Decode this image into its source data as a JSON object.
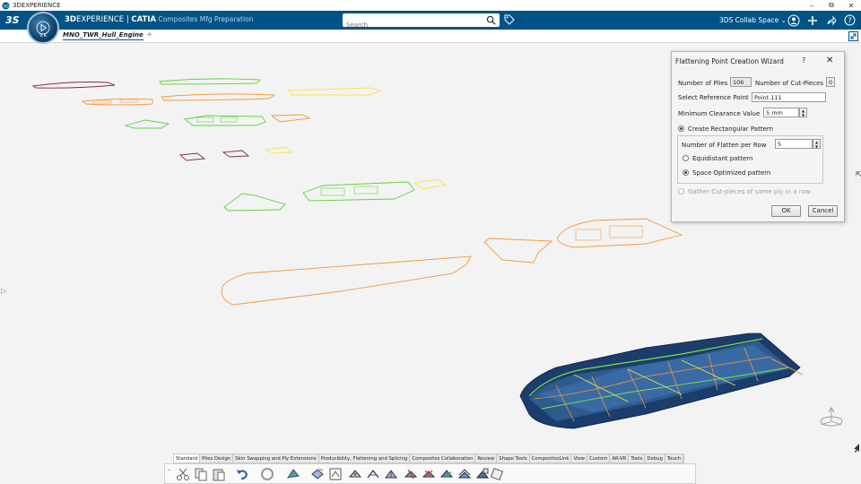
{
  "os": {
    "title": "3DEXPERIENCE",
    "minimize": "–",
    "restore": "⧉",
    "close": "✕"
  },
  "header": {
    "brand_bold": "3D",
    "brand_regular": "EXPERIENCE | ",
    "brand_app_bold": "CATIA",
    "brand_app": " Composites Mfg Preparation",
    "compass_version": "V.R",
    "search_placeholder": "Search",
    "collab_space": "3DS Collab Space ⌄"
  },
  "tabs": {
    "document": "MNO_TWR_Hull_Engineeri",
    "add": "+"
  },
  "dialog": {
    "title": "Flattening Point Creation Wizard",
    "help": "?",
    "close": "✕",
    "plies_label": "Number of Plies",
    "plies_value": "106",
    "cutpieces_label": "Number of Cut-Pieces",
    "cutpieces_value": "0",
    "ref_point_label": "Select Reference Point",
    "ref_point_value": "Point.111",
    "clearance_label": "Minimum Clearance Value",
    "clearance_value": "5 mm",
    "rect_pattern_label": "Create Rectangular Pattern",
    "flatten_per_row_label": "Number of Flatten per Row",
    "flatten_per_row_value": "5",
    "equidistant_label": "Equidistant pattern",
    "space_optimized_label": "Space Optimized pattern",
    "gather_label": "Gather Cut-pieces of same ply in a row",
    "ok": "OK",
    "cancel": "Cancel"
  },
  "toolbar": {
    "tabs": [
      "Standard",
      "Plies Design",
      "Skin Swapping and Ply Extensions",
      "Producibility, Flattening and Splicing",
      "Composites Collaboration",
      "Review",
      "Shape Tools",
      "CompositesLink",
      "View",
      "Custom",
      "AR-VR",
      "Tools",
      "Debug",
      "Touch"
    ],
    "active_tab": "Standard",
    "collapse": "⌄"
  },
  "icons": {
    "logo": "ds-logo-icon",
    "search": "search-icon",
    "tag": "tag-icon",
    "user": "user-icon",
    "add": "plus-icon",
    "share": "share-icon",
    "help": "help-icon",
    "expand": "expand-icon"
  },
  "colors": {
    "header": "#005386",
    "orange": "#f39a3c",
    "green": "#5fd43c",
    "yellow": "#f2e84a",
    "maroon": "#8a2a3a"
  }
}
